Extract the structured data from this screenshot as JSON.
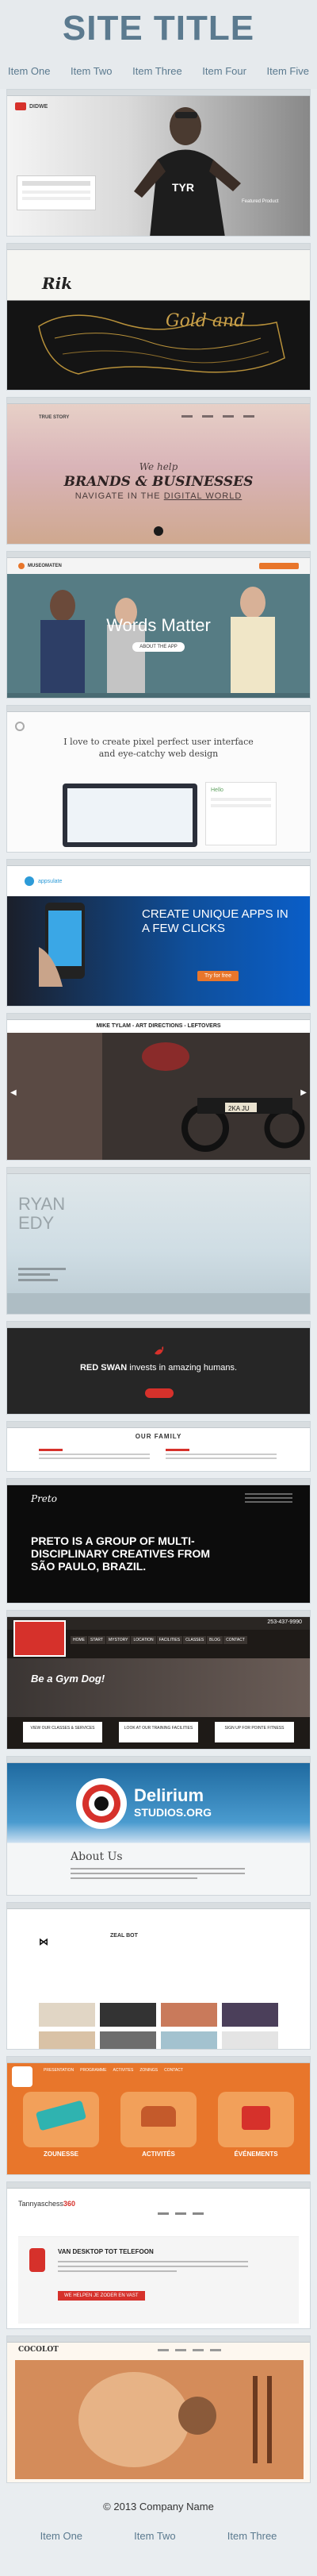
{
  "header": {
    "title": "SITE TITLE"
  },
  "nav": [
    "Item One",
    "Item Two",
    "Item Three",
    "Item Four",
    "Item Five"
  ],
  "shots": {
    "s1": {
      "logo": "DIDWE",
      "caption": "Featured Product"
    },
    "s2": {
      "logo": "Rik",
      "script": "Gold and"
    },
    "s3": {
      "logo": "TRUE STORY",
      "line1": "We help",
      "line2": "BRANDS & BUSINESSES",
      "line3_pre": "NAVIGATE IN THE ",
      "line3_link": "DIGITAL WORLD"
    },
    "s4": {
      "logo": "MUSEOMATEN",
      "headline": "Words Matter",
      "cta": "ABOUT THE APP"
    },
    "s5": {
      "tagline": "I love to create pixel perfect user interface and eye-catchy web design",
      "panel": "Hello"
    },
    "s6": {
      "logo": "appsulate",
      "headline": "CREATE UNIQUE APPS IN A FEW CLICKS",
      "cta": "Try for free"
    },
    "s7": {
      "title": "MIKE TYLAM - ART DIRECTIONS - LEFTOVERS",
      "plate": "2KA JU"
    },
    "s8": {
      "name1": "RYAN",
      "name2": "EDY"
    },
    "s9": {
      "brand": "RED SWAN",
      "tag": "invests in amazing humans."
    },
    "s10": {
      "heading": "OUR FAMILY"
    },
    "s11": {
      "logo": "Preto",
      "headline": "PRETO IS A GROUP OF MULTI-DISCIPLINARY CREATIVES FROM SÃO PAULO, BRAZIL."
    },
    "s12": {
      "phone": "253-437-9990",
      "menu": [
        "HOME",
        "START",
        "MYSTORY",
        "LOCATION",
        "FACILITIES",
        "CLASSES",
        "BLOG",
        "CONTACT"
      ],
      "headline": "Be a Gym Dog!",
      "boxes": [
        "VIEW OUR CLASSES & SERVICES",
        "LOOK AT OUR TRAINING FACILITIES",
        "SIGN UP FOR POINTE FITNESS"
      ]
    },
    "s13": {
      "logo1": "Delirium",
      "logo2": "STUDIOS.ORG",
      "heading": "About Us"
    },
    "s14": {
      "label": "ZEAL BOT"
    },
    "s15": {
      "menu": [
        "PRESENTATION",
        "PROGRAMME",
        "ACTIVITES",
        "ZONINGS",
        "CONTACT"
      ],
      "labels": [
        "ZOUNESSE",
        "ACTIVITÉS",
        "ÉVÉNEMENTS"
      ]
    },
    "s16": {
      "logo_pre": "Tannyaschess",
      "logo_num": "360",
      "headline": "VAN DESKTOP TOT TELEFOON",
      "cta": "WE HELPEN JE ZODER EN VAST"
    },
    "s17": {
      "logo": "COCOLOT"
    }
  },
  "footer": {
    "copyright": "© 2013 Company Name",
    "nav": [
      "Item One",
      "Item Two",
      "Item Three"
    ]
  },
  "colors": {
    "accent": "#5b7a8f",
    "orange": "#e8762b",
    "red": "#d6312b",
    "blue": "#2d9bd8"
  }
}
